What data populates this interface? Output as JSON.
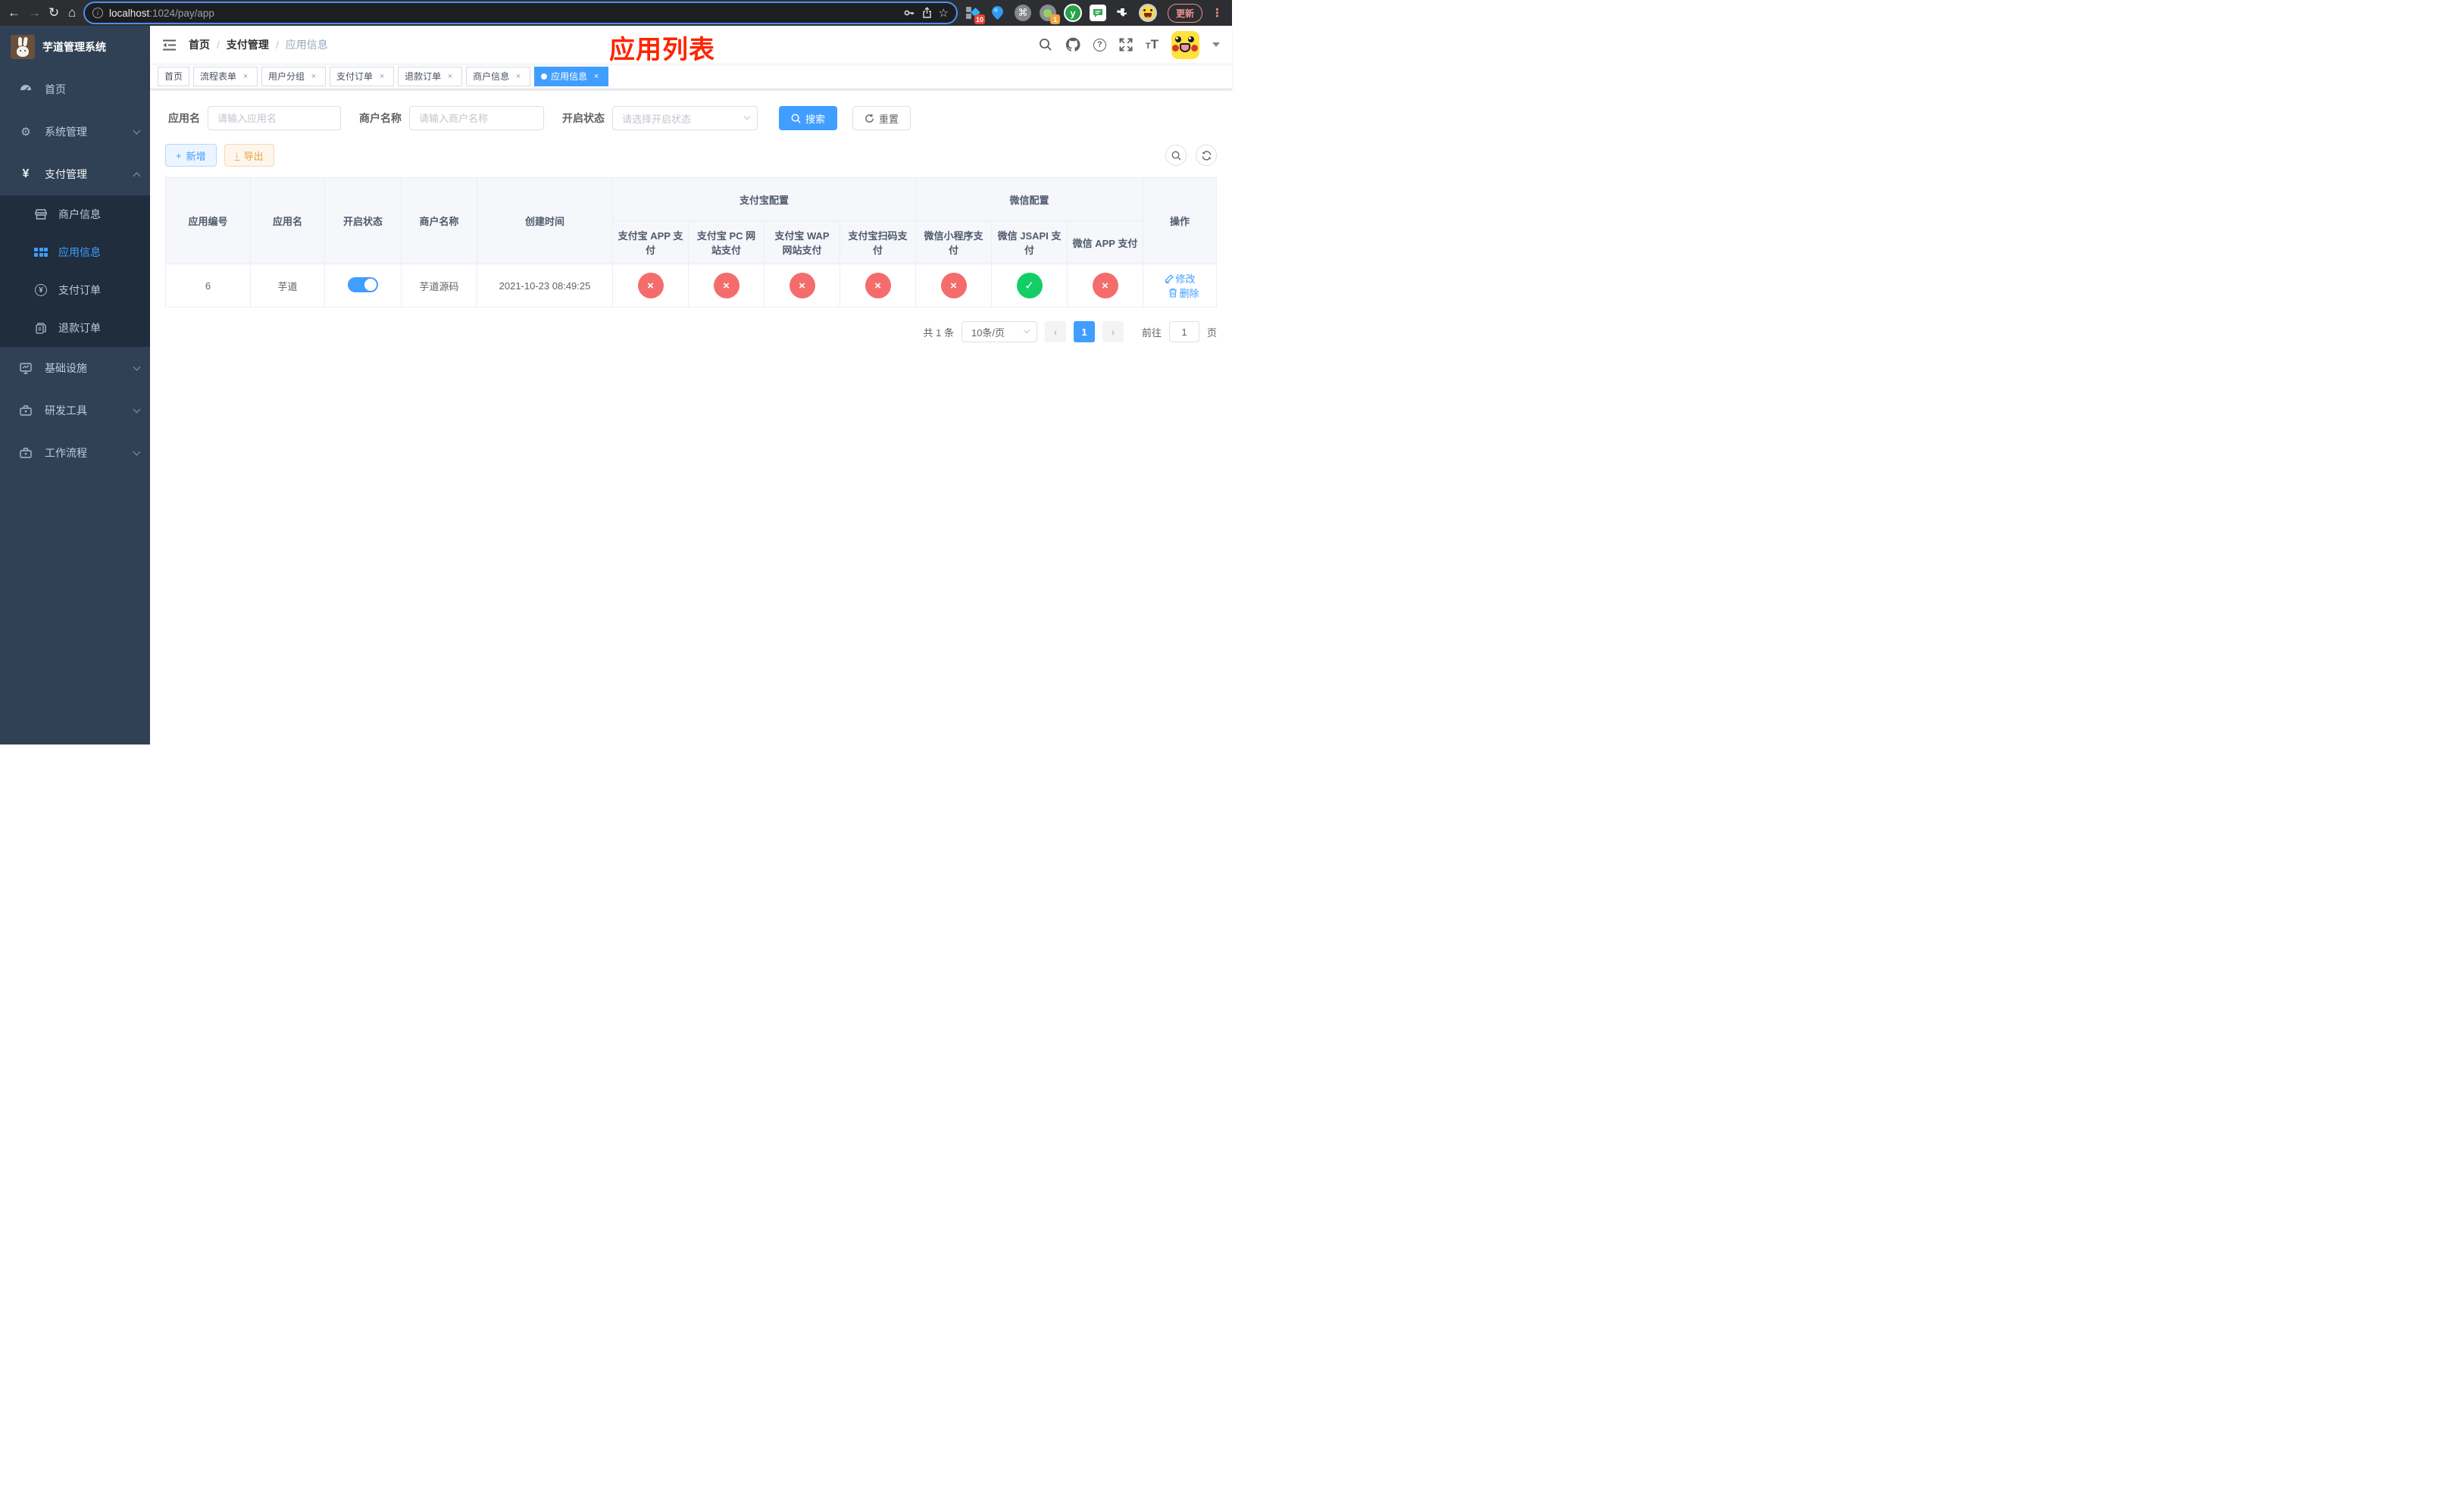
{
  "colors": {
    "accent": "#409eff",
    "danger": "#f56c6c",
    "success": "#13ce66",
    "warning": "#e6a23c",
    "title_red": "#ff2400"
  },
  "icons": {
    "back": "←",
    "forward": "→",
    "reload": "↻",
    "home": "⌂",
    "info": "i",
    "star": "☆",
    "command": "⌘",
    "dots": "⋮",
    "help": "?",
    "font_big": "T",
    "font_small": "T",
    "plus": "+",
    "download": "↓",
    "close": "×",
    "check": "✓",
    "cross": "×",
    "prev": "‹",
    "next": "›",
    "yen": "¥",
    "gear": "⚙",
    "y_letter": "y"
  },
  "browser": {
    "url_host": "localhost",
    "url_path": ":1024/pay/app",
    "update_label": "更新",
    "ext_badge_tabs": "10",
    "ext_badge_target": "1"
  },
  "sidebar": {
    "logo_title": "芋道管理系统",
    "items": [
      {
        "label": "首页"
      },
      {
        "label": "系统管理"
      },
      {
        "label": "支付管理"
      },
      {
        "label": "基础设施"
      },
      {
        "label": "研发工具"
      },
      {
        "label": "工作流程"
      }
    ],
    "payment_children": [
      {
        "label": "商户信息"
      },
      {
        "label": "应用信息"
      },
      {
        "label": "支付订单"
      },
      {
        "label": "退款订单"
      }
    ]
  },
  "navbar": {
    "breadcrumb": [
      "首页",
      "支付管理",
      "应用信息"
    ],
    "separator": "/",
    "page_title": "应用列表"
  },
  "tabs": [
    {
      "label": "首页"
    },
    {
      "label": "流程表单"
    },
    {
      "label": "用户分组"
    },
    {
      "label": "支付订单"
    },
    {
      "label": "退款订单"
    },
    {
      "label": "商户信息"
    },
    {
      "label": "应用信息"
    }
  ],
  "filters": {
    "app_name_label": "应用名",
    "app_name_placeholder": "请输入应用名",
    "merchant_label": "商户名称",
    "merchant_placeholder": "请输入商户名称",
    "status_label": "开启状态",
    "status_placeholder": "请选择开启状态",
    "search_label": "搜索",
    "reset_label": "重置"
  },
  "toolbar": {
    "add_label": "新增",
    "export_label": "导出"
  },
  "table": {
    "group_alipay": "支付宝配置",
    "group_wechat": "微信配置",
    "columns": [
      "应用编号",
      "应用名",
      "开启状态",
      "商户名称",
      "创建时间",
      "支付宝 APP 支付",
      "支付宝 PC 网站支付",
      "支付宝 WAP 网站支付",
      "支付宝扫码支付",
      "微信小程序支付",
      "微信 JSAPI 支付",
      "微信 APP 支付",
      "操作"
    ],
    "row": {
      "id": "6",
      "name": "芋道",
      "enabled": true,
      "merchant": "芋道源码",
      "created_at": "2021-10-23 08:49:25",
      "payment_statuses": [
        false,
        false,
        false,
        false,
        false,
        true,
        false
      ],
      "edit_label": "修改",
      "delete_label": "删除"
    }
  },
  "pagination": {
    "total": "共 1 条",
    "page_size": "10条/页",
    "current_page": "1",
    "goto_label": "前往",
    "goto_value": "1",
    "unit_label": "页"
  }
}
